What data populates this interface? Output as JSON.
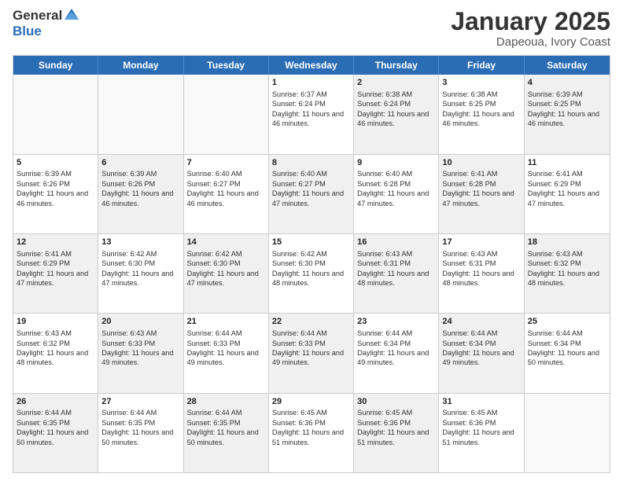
{
  "header": {
    "logo_general": "General",
    "logo_blue": "Blue",
    "month": "January 2025",
    "location": "Dapeoua, Ivory Coast"
  },
  "weekdays": [
    "Sunday",
    "Monday",
    "Tuesday",
    "Wednesday",
    "Thursday",
    "Friday",
    "Saturday"
  ],
  "weeks": [
    [
      {
        "day": "",
        "info": "",
        "shaded": true
      },
      {
        "day": "",
        "info": "",
        "shaded": true
      },
      {
        "day": "",
        "info": "",
        "shaded": true
      },
      {
        "day": "1",
        "info": "Sunrise: 6:37 AM\nSunset: 6:24 PM\nDaylight: 11 hours and 46 minutes.",
        "shaded": false
      },
      {
        "day": "2",
        "info": "Sunrise: 6:38 AM\nSunset: 6:24 PM\nDaylight: 11 hours and 46 minutes.",
        "shaded": true
      },
      {
        "day": "3",
        "info": "Sunrise: 6:38 AM\nSunset: 6:25 PM\nDaylight: 11 hours and 46 minutes.",
        "shaded": false
      },
      {
        "day": "4",
        "info": "Sunrise: 6:39 AM\nSunset: 6:25 PM\nDaylight: 11 hours and 46 minutes.",
        "shaded": true
      }
    ],
    [
      {
        "day": "5",
        "info": "Sunrise: 6:39 AM\nSunset: 6:26 PM\nDaylight: 11 hours and 46 minutes.",
        "shaded": false
      },
      {
        "day": "6",
        "info": "Sunrise: 6:39 AM\nSunset: 6:26 PM\nDaylight: 11 hours and 46 minutes.",
        "shaded": true
      },
      {
        "day": "7",
        "info": "Sunrise: 6:40 AM\nSunset: 6:27 PM\nDaylight: 11 hours and 46 minutes.",
        "shaded": false
      },
      {
        "day": "8",
        "info": "Sunrise: 6:40 AM\nSunset: 6:27 PM\nDaylight: 11 hours and 47 minutes.",
        "shaded": true
      },
      {
        "day": "9",
        "info": "Sunrise: 6:40 AM\nSunset: 6:28 PM\nDaylight: 11 hours and 47 minutes.",
        "shaded": false
      },
      {
        "day": "10",
        "info": "Sunrise: 6:41 AM\nSunset: 6:28 PM\nDaylight: 11 hours and 47 minutes.",
        "shaded": true
      },
      {
        "day": "11",
        "info": "Sunrise: 6:41 AM\nSunset: 6:29 PM\nDaylight: 11 hours and 47 minutes.",
        "shaded": false
      }
    ],
    [
      {
        "day": "12",
        "info": "Sunrise: 6:41 AM\nSunset: 6:29 PM\nDaylight: 11 hours and 47 minutes.",
        "shaded": true
      },
      {
        "day": "13",
        "info": "Sunrise: 6:42 AM\nSunset: 6:30 PM\nDaylight: 11 hours and 47 minutes.",
        "shaded": false
      },
      {
        "day": "14",
        "info": "Sunrise: 6:42 AM\nSunset: 6:30 PM\nDaylight: 11 hours and 47 minutes.",
        "shaded": true
      },
      {
        "day": "15",
        "info": "Sunrise: 6:42 AM\nSunset: 6:30 PM\nDaylight: 11 hours and 48 minutes.",
        "shaded": false
      },
      {
        "day": "16",
        "info": "Sunrise: 6:43 AM\nSunset: 6:31 PM\nDaylight: 11 hours and 48 minutes.",
        "shaded": true
      },
      {
        "day": "17",
        "info": "Sunrise: 6:43 AM\nSunset: 6:31 PM\nDaylight: 11 hours and 48 minutes.",
        "shaded": false
      },
      {
        "day": "18",
        "info": "Sunrise: 6:43 AM\nSunset: 6:32 PM\nDaylight: 11 hours and 48 minutes.",
        "shaded": true
      }
    ],
    [
      {
        "day": "19",
        "info": "Sunrise: 6:43 AM\nSunset: 6:32 PM\nDaylight: 11 hours and 48 minutes.",
        "shaded": false
      },
      {
        "day": "20",
        "info": "Sunrise: 6:43 AM\nSunset: 6:33 PM\nDaylight: 11 hours and 49 minutes.",
        "shaded": true
      },
      {
        "day": "21",
        "info": "Sunrise: 6:44 AM\nSunset: 6:33 PM\nDaylight: 11 hours and 49 minutes.",
        "shaded": false
      },
      {
        "day": "22",
        "info": "Sunrise: 6:44 AM\nSunset: 6:33 PM\nDaylight: 11 hours and 49 minutes.",
        "shaded": true
      },
      {
        "day": "23",
        "info": "Sunrise: 6:44 AM\nSunset: 6:34 PM\nDaylight: 11 hours and 49 minutes.",
        "shaded": false
      },
      {
        "day": "24",
        "info": "Sunrise: 6:44 AM\nSunset: 6:34 PM\nDaylight: 11 hours and 49 minutes.",
        "shaded": true
      },
      {
        "day": "25",
        "info": "Sunrise: 6:44 AM\nSunset: 6:34 PM\nDaylight: 11 hours and 50 minutes.",
        "shaded": false
      }
    ],
    [
      {
        "day": "26",
        "info": "Sunrise: 6:44 AM\nSunset: 6:35 PM\nDaylight: 11 hours and 50 minutes.",
        "shaded": true
      },
      {
        "day": "27",
        "info": "Sunrise: 6:44 AM\nSunset: 6:35 PM\nDaylight: 11 hours and 50 minutes.",
        "shaded": false
      },
      {
        "day": "28",
        "info": "Sunrise: 6:44 AM\nSunset: 6:35 PM\nDaylight: 11 hours and 50 minutes.",
        "shaded": true
      },
      {
        "day": "29",
        "info": "Sunrise: 6:45 AM\nSunset: 6:36 PM\nDaylight: 11 hours and 51 minutes.",
        "shaded": false
      },
      {
        "day": "30",
        "info": "Sunrise: 6:45 AM\nSunset: 6:36 PM\nDaylight: 11 hours and 51 minutes.",
        "shaded": true
      },
      {
        "day": "31",
        "info": "Sunrise: 6:45 AM\nSunset: 6:36 PM\nDaylight: 11 hours and 51 minutes.",
        "shaded": false
      },
      {
        "day": "",
        "info": "",
        "shaded": true
      }
    ]
  ]
}
